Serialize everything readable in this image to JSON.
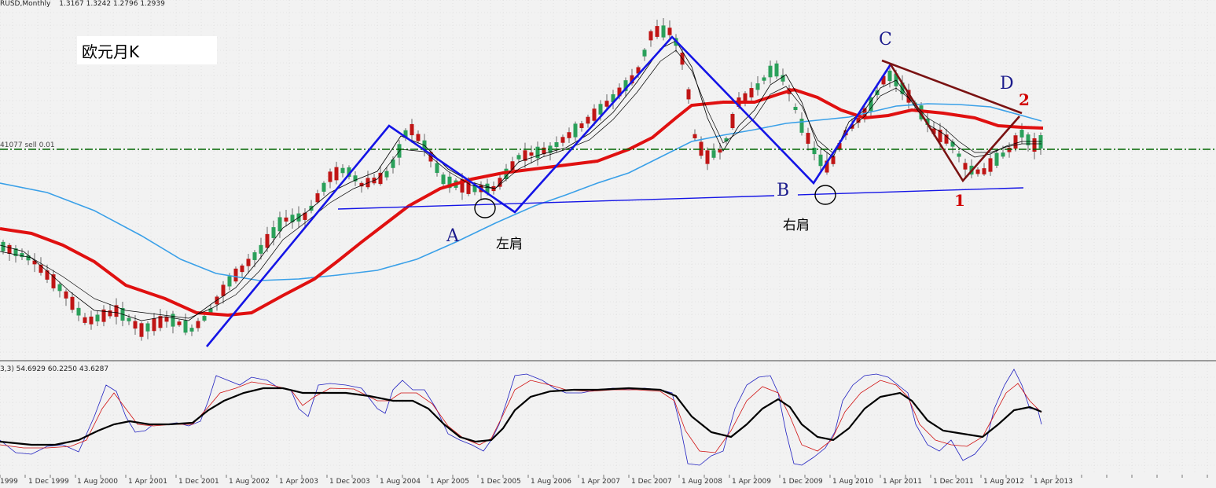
{
  "header": {
    "symbol_label": "RUSD,Monthly",
    "ohlc": "1.3167 1.3242 1.2796 1.2939",
    "hline_label": "41077 sell 0.01",
    "indicator_label": "3,3) 54.6929 60.2250 43.6287"
  },
  "title": "欧元月K",
  "annotations": {
    "A": "A",
    "B": "B",
    "C": "C",
    "D": "D",
    "left_shoulder": "左肩",
    "right_shoulder": "右肩",
    "wave_1": "1",
    "wave_2": "2"
  },
  "x_axis": {
    "labels": [
      "1999",
      "1 Dec 1999",
      "1 Aug 2000",
      "1 Apr 2001",
      "1 Dec 2001",
      "1 Aug 2002",
      "1 Apr 2003",
      "1 Dec 2003",
      "1 Aug 2004",
      "1 Apr 2005",
      "1 Dec 2005",
      "1 Aug 2006",
      "1 Apr 2007",
      "1 Dec 2007",
      "1 Aug 2008",
      "1 Apr 2009",
      "1 Dec 2009",
      "1 Aug 2010",
      "1 Apr 2011",
      "1 Dec 2011",
      "1 Aug 2012",
      "1 Apr 2013"
    ]
  },
  "colors": {
    "background": "#f2f2f2",
    "bull_candle": "#2aa05a",
    "bear_candle": "#c01515",
    "ma_red": "#e01010",
    "ma_blue": "#3aa0e8",
    "pattern_blue": "#1414e6",
    "pattern_brown": "#7a1212",
    "hline": "#006400"
  }
}
